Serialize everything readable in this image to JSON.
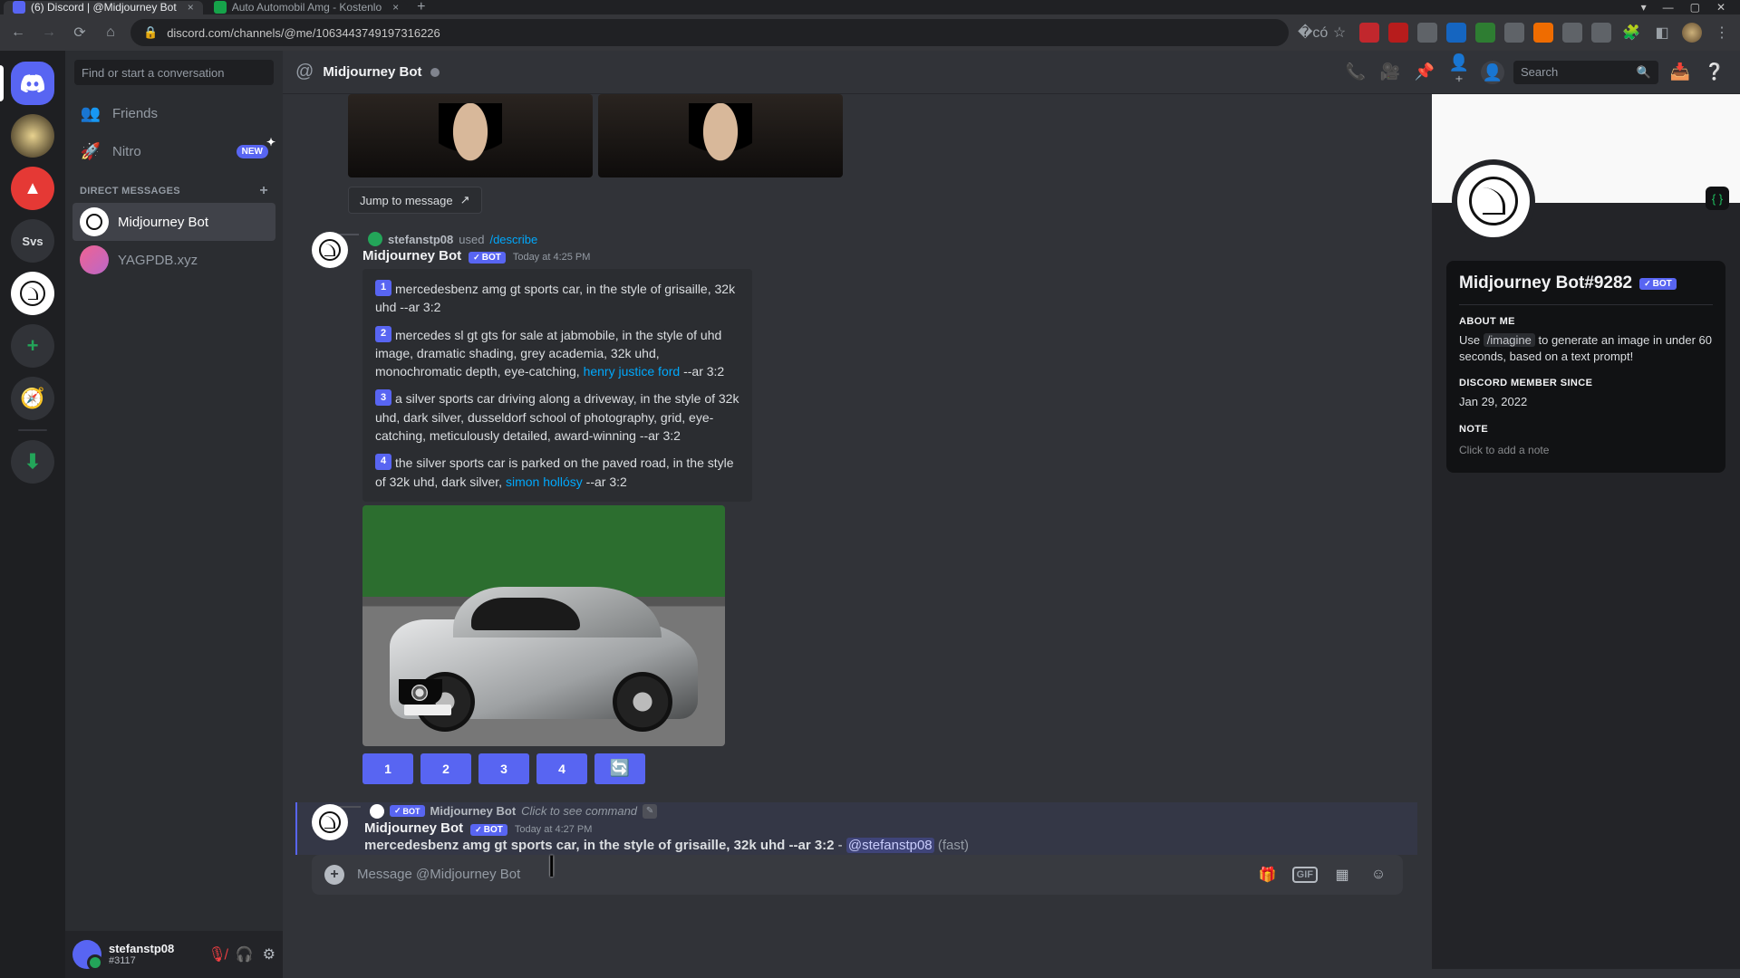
{
  "browser": {
    "tabs": [
      {
        "title": "(6) Discord | @Midjourney Bot",
        "active": true
      },
      {
        "title": "Auto Automobil Amg - Kostenlo",
        "active": false
      }
    ],
    "url": "discord.com/channels/@me/1063443749197316226"
  },
  "servers": {
    "labels": {
      "svs": "Svs"
    }
  },
  "sidebar": {
    "search_placeholder": "Find or start a conversation",
    "friends": "Friends",
    "nitro": "Nitro",
    "nitro_badge": "NEW",
    "dm_heading": "DIRECT MESSAGES",
    "dms": [
      {
        "name": "Midjourney Bot",
        "active": true
      },
      {
        "name": "YAGPDB.xyz",
        "active": false
      }
    ]
  },
  "user_panel": {
    "username": "stefanstp08",
    "discriminator": "#3117"
  },
  "header": {
    "title": "Midjourney Bot",
    "search_placeholder": "Search"
  },
  "jump_button": "Jump to message",
  "msg1": {
    "reply_user": "stefanstp08",
    "reply_action": "used",
    "reply_cmd": "/describe",
    "author": "Midjourney Bot",
    "bot_label": "BOT",
    "timestamp": "Today at 4:25 PM",
    "desc": {
      "p1a": "mercedesbenz amg gt sports car, in the style of grisaille, 32k uhd --ar 3:2",
      "p2a": "mercedes sl gt gts for sale at jabmobile, in the style of uhd image, dramatic shading, grey academia, 32k uhd, monochromatic depth, eye-catching, ",
      "p2link": "henry justice ford",
      "p2b": " --ar 3:2",
      "p3a": "a silver sports car driving along a driveway, in the style of 32k uhd, dark silver, dusseldorf school of photography, grid, eye-catching, meticulously detailed, award-winning --ar 3:2",
      "p4a": "the silver sports car is parked on the paved road, in the style of 32k uhd, dark silver, ",
      "p4link": "simon hollósy",
      "p4b": " --ar 3:2"
    },
    "buttons": {
      "b1": "1",
      "b2": "2",
      "b3": "3",
      "b4": "4"
    }
  },
  "msg2": {
    "reply_bot": "Midjourney Bot",
    "reply_text": "Click to see command",
    "author": "Midjourney Bot",
    "bot_label": "BOT",
    "timestamp": "Today at 4:27 PM",
    "content_bold": "mercedesbenz amg gt sports car, in the style of grisaille, 32k uhd --ar 3:2",
    "dash": " - ",
    "mention": "@stefanstp08",
    "fast": " (fast)"
  },
  "composer": {
    "placeholder": "Message @Midjourney Bot",
    "gif": "GIF"
  },
  "profile": {
    "name": "Midjourney Bot#9282",
    "bot_label": "BOT",
    "about_h": "ABOUT ME",
    "about_pre": "Use ",
    "about_cmd": "/imagine",
    "about_post": " to generate an image in under 60 seconds, based on a text prompt!",
    "since_h": "DISCORD MEMBER SINCE",
    "since_date": "Jan 29, 2022",
    "note_h": "NOTE",
    "note_placeholder": "Click to add a note",
    "code_badge": "{ }"
  }
}
